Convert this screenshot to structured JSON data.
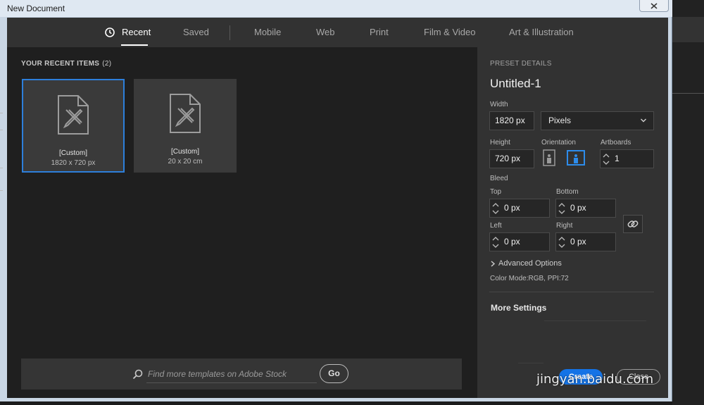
{
  "window": {
    "title": "New Document"
  },
  "tabs": [
    {
      "label": "Recent",
      "active": true,
      "icon": "clock-icon"
    },
    {
      "label": "Saved"
    },
    {
      "label": "Mobile"
    },
    {
      "label": "Web"
    },
    {
      "label": "Print"
    },
    {
      "label": "Film & Video"
    },
    {
      "label": "Art & Illustration"
    }
  ],
  "recent": {
    "heading": "YOUR RECENT ITEMS",
    "count": "(2)",
    "items": [
      {
        "name": "[Custom]",
        "dims": "1820 x 720 px",
        "selected": true
      },
      {
        "name": "[Custom]",
        "dims": "20 x 20 cm",
        "selected": false
      }
    ]
  },
  "search": {
    "placeholder": "Find more templates on Adobe Stock",
    "go_label": "Go"
  },
  "preset": {
    "heading": "PRESET DETAILS",
    "doc_name": "Untitled-1",
    "width_label": "Width",
    "width_value": "1820 px",
    "units": "Pixels",
    "height_label": "Height",
    "height_value": "720 px",
    "orientation_label": "Orientation",
    "artboards_label": "Artboards",
    "artboards_value": "1",
    "bleed_label": "Bleed",
    "top_label": "Top",
    "top_value": "0 px",
    "bottom_label": "Bottom",
    "bottom_value": "0 px",
    "left_label": "Left",
    "left_value": "0 px",
    "right_label": "Right",
    "right_value": "0 px",
    "advanced_label": "Advanced Options",
    "color_mode": "Color Mode:RGB, PPI:72",
    "more_settings": "More Settings",
    "create_label": "Create",
    "close_label": "Close"
  },
  "watermark": "jingyan.baidu.com",
  "colors": {
    "accent": "#1473e6",
    "selection": "#2d7fdb",
    "panel": "#323232",
    "background": "#1f1f1f"
  }
}
